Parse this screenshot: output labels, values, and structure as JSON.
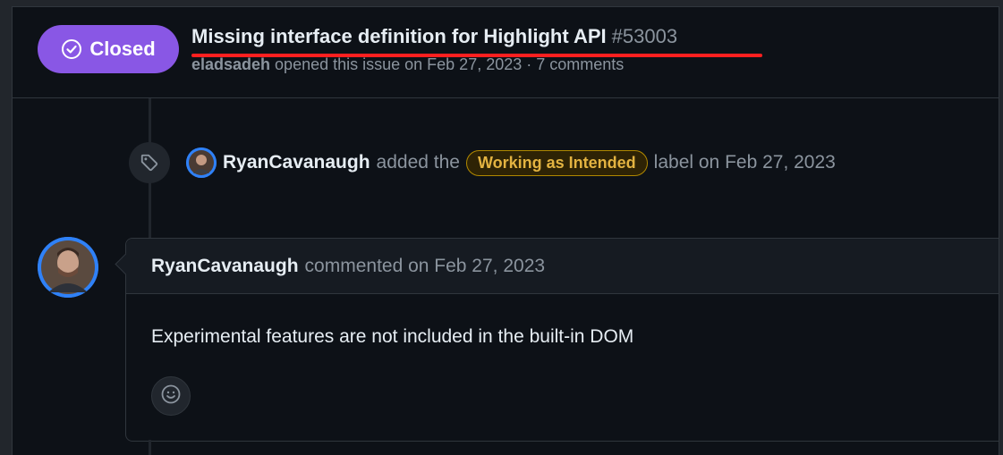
{
  "issue": {
    "state": "Closed",
    "title": "Missing interface definition for Highlight API",
    "number": "#53003",
    "author": "eladsadeh",
    "opened_text": " opened this issue on Feb 27, 2023 · 7 comments"
  },
  "label_event": {
    "actor": "RyanCavanaugh",
    "action": "added the",
    "label": "Working as Intended",
    "suffix": "label on Feb 27, 2023"
  },
  "comment": {
    "author": "RyanCavanaugh",
    "meta": "commented on Feb 27, 2023",
    "body": "Experimental features are not included in the built-in DOM"
  },
  "colors": {
    "closed_badge": "#8957e5",
    "label_text": "#e3b341",
    "highlight_underline": "#ff1f1f"
  },
  "icons": {
    "state": "check-circle-icon",
    "event": "tag-icon",
    "reaction": "smiley-icon"
  }
}
